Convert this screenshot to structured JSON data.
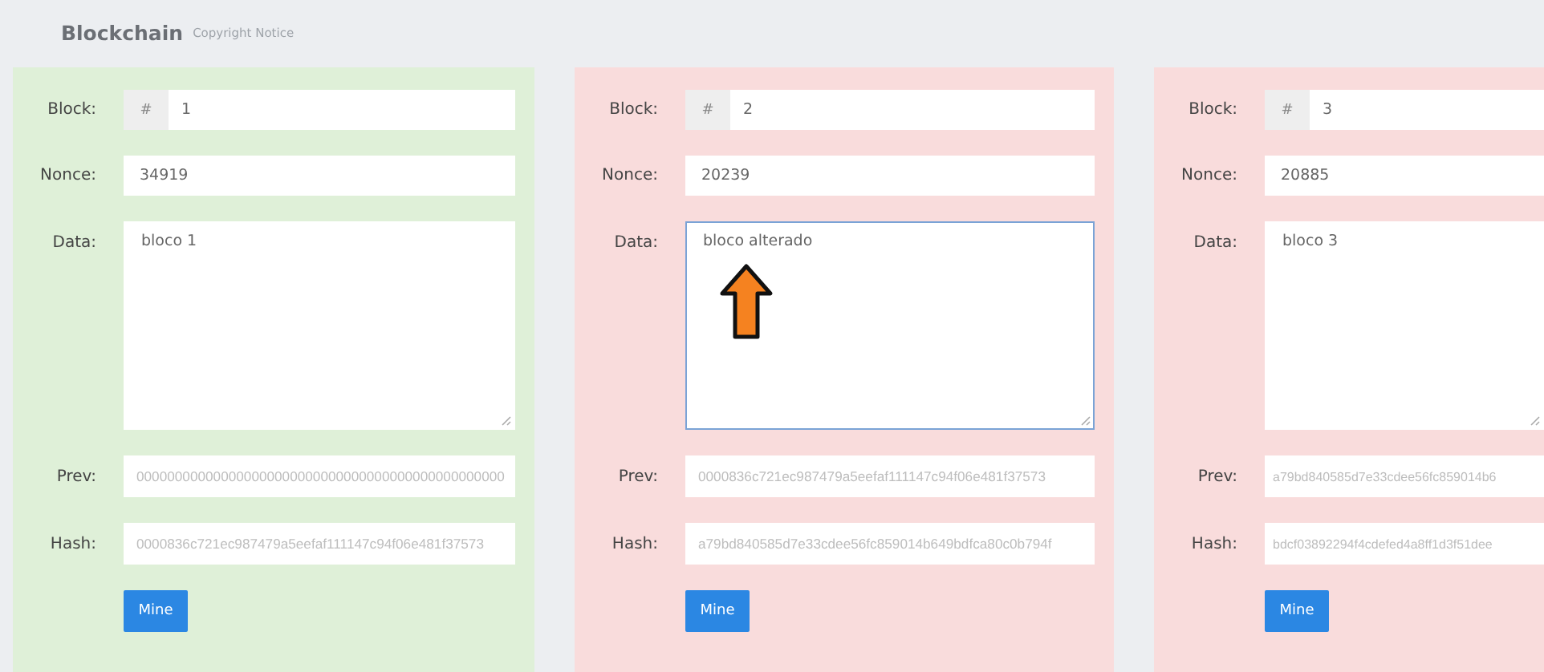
{
  "header": {
    "title": "Blockchain",
    "subtitle": "Copyright Notice"
  },
  "blocks": [
    {
      "valid": true,
      "labels": {
        "block": "Block:",
        "nonce": "Nonce:",
        "data": "Data:",
        "prev": "Prev:",
        "hash": "Hash:"
      },
      "prefix": "#",
      "number": "1",
      "nonce": "34919",
      "data": "bloco 1",
      "data_focused": false,
      "prev": "000000000000000000000000000000000000000000000000",
      "hash": "0000836c721ec987479a5eefaf111147c94f06e481f37573",
      "button": "Mine",
      "annotation": false
    },
    {
      "valid": false,
      "labels": {
        "block": "Block:",
        "nonce": "Nonce:",
        "data": "Data:",
        "prev": "Prev:",
        "hash": "Hash:"
      },
      "prefix": "#",
      "number": "2",
      "nonce": "20239",
      "data": "bloco alterado",
      "data_focused": true,
      "prev": "0000836c721ec987479a5eefaf111147c94f06e481f37573",
      "hash": "a79bd840585d7e33cdee56fc859014b649bdfca80c0b794f",
      "button": "Mine",
      "annotation": true
    },
    {
      "valid": false,
      "labels": {
        "block": "Block:",
        "nonce": "Nonce:",
        "data": "Data:",
        "prev": "Prev:",
        "hash": "Hash:"
      },
      "prefix": "#",
      "number": "3",
      "nonce": "20885",
      "data": "bloco 3",
      "data_focused": false,
      "prev": "a79bd840585d7e33cdee56fc859014b6",
      "hash": "bdcf03892294f4cdefed4a8ff1d3f51dee",
      "button": "Mine",
      "annotation": false
    }
  ]
}
